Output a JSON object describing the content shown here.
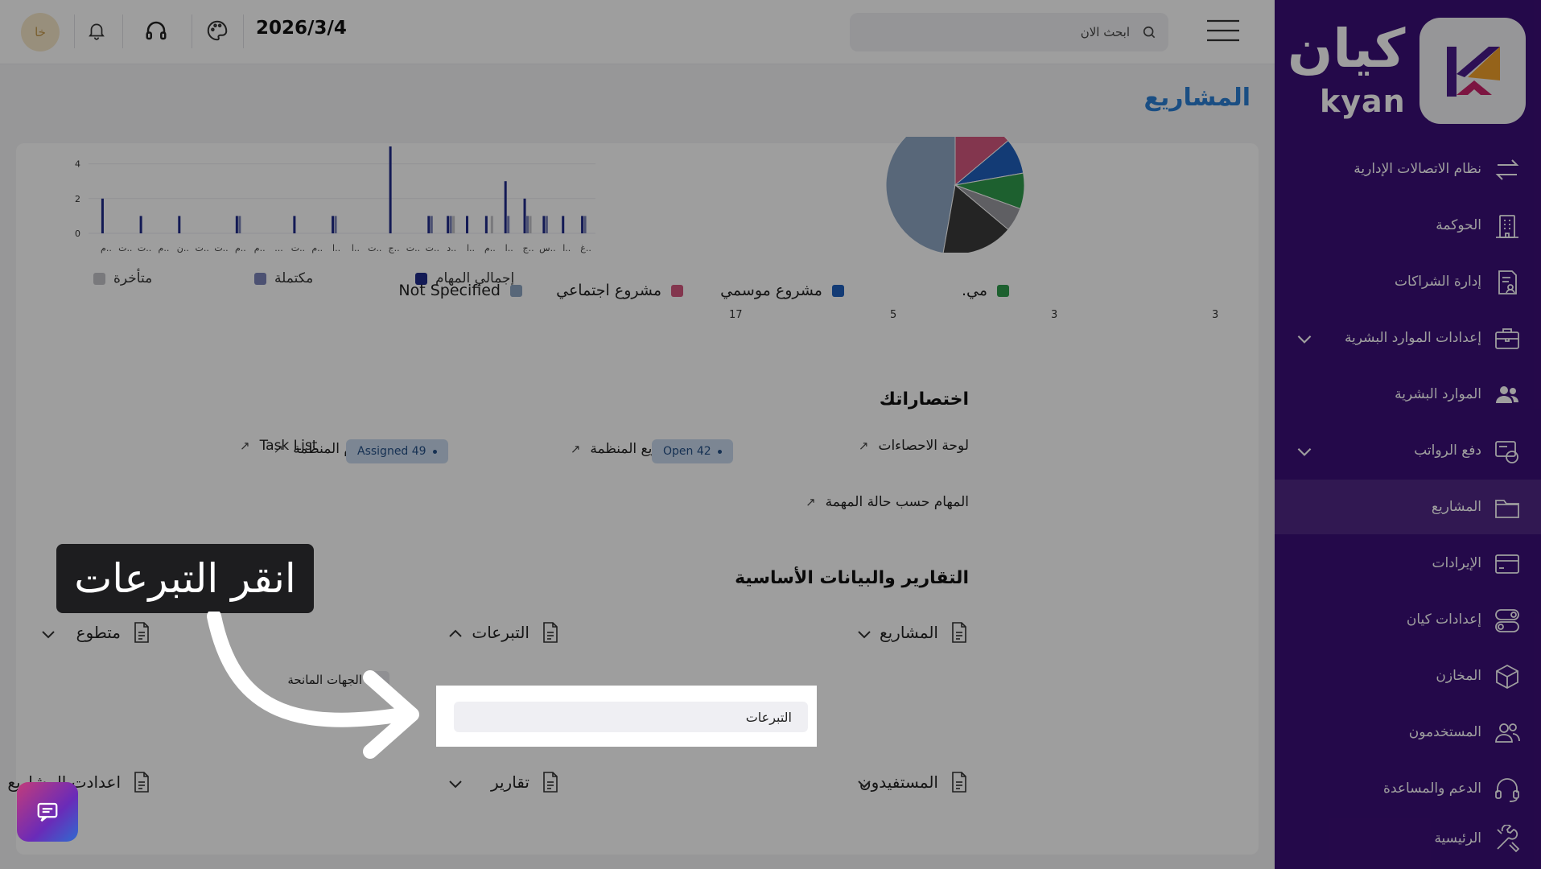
{
  "topbar": {
    "avatar_initials": "خا",
    "date": "2026/3/4",
    "search_placeholder": "ابحث الان"
  },
  "page_title": "المشاريع",
  "bar_chart": {
    "chart_data": {
      "type": "bar",
      "categories": [
        "م..",
        "ت..",
        "ت..",
        "م..",
        "ن..",
        "ت..",
        "ت..",
        "م..",
        "م..",
        "...",
        "ت..",
        "م..",
        "ا..",
        "ا..",
        "ت..",
        "ج..",
        "ت..",
        "ت..",
        "د..",
        "ا..",
        "م..",
        "ا..",
        "ج..",
        "س..",
        "ا..",
        "غ.."
      ],
      "series": [
        {
          "name": "إجمالي المهام",
          "values": [
            2,
            0,
            1,
            0,
            1,
            0,
            0,
            1,
            0,
            0,
            1,
            0,
            1,
            0,
            0,
            5,
            0,
            1,
            1,
            1,
            1,
            3,
            2,
            1,
            1,
            1
          ]
        },
        {
          "name": "مكتملة",
          "values": [
            0,
            0,
            0,
            0,
            0,
            0,
            0,
            1,
            0,
            0,
            0,
            0,
            1,
            0,
            0,
            0,
            0,
            1,
            1,
            0,
            0,
            1,
            1,
            1,
            0,
            1
          ]
        },
        {
          "name": "متأخرة",
          "values": [
            0,
            0,
            0,
            0,
            0,
            0,
            0,
            0,
            0,
            0,
            0,
            0,
            0,
            0,
            0,
            0,
            0,
            0,
            1,
            0,
            1,
            0,
            1,
            0,
            0,
            0
          ]
        }
      ],
      "ylim": [
        0,
        5
      ],
      "yticks": [
        "0",
        "2",
        "4"
      ],
      "legend": "bottom"
    },
    "colors": {
      "total": "#1f2a8a",
      "completed": "#7b83b8",
      "late": "#c4c4c8"
    }
  },
  "pie_chart": {
    "chart_data": {
      "type": "pie",
      "labels": [
        "Not Specified",
        "مشروع اجتماعي",
        "مشروع موسمي",
        "مي."
      ],
      "values": [
        17,
        5,
        3,
        3
      ],
      "value_labels": [
        "17",
        "5",
        "3",
        "3"
      ]
    },
    "colors": [
      "#8ea7c4",
      "#d3577f",
      "#1f5fbd",
      "#2f9b4c",
      "#9a9aa0",
      "#3a3a3a"
    ]
  },
  "shortcuts": {
    "title": "اختصاراتك",
    "items": [
      {
        "label": "لوحة الاحصاءات"
      },
      {
        "label": "مشاريع المنظمة"
      },
      {
        "label": "مهام المنظمة",
        "badge": "Open 42"
      },
      {
        "label": "Task List",
        "badge": "Assigned 49"
      },
      {
        "label": "المهام حسب حالة المهمة"
      }
    ]
  },
  "reports": {
    "title": "التقارير والبيانات الأساسية",
    "row1": [
      "المشاريع",
      "التبرعات",
      "متطوع"
    ],
    "row2": [
      "المستفيدون",
      "تقارير",
      "اعدادت المشاريع"
    ],
    "submenu": [
      "الجهات المانحة",
      "التبرعات"
    ]
  },
  "sidebar": {
    "brand_ar": "كيان",
    "brand_en": "kyan",
    "items": [
      {
        "label": "نظام الاتصالات الإدارية",
        "icon": "arrows-exchange-icon"
      },
      {
        "label": "الحوكمة",
        "icon": "building-icon"
      },
      {
        "label": "إدارة الشراكات",
        "icon": "document-user-icon"
      },
      {
        "label": "إعدادات الموارد البشرية",
        "icon": "briefcase-icon"
      },
      {
        "label": "الموارد البشرية",
        "icon": "users-icon"
      },
      {
        "label": "دفع الرواتب",
        "icon": "coins-icon"
      },
      {
        "label": "المشاريع",
        "icon": "folder-icon"
      },
      {
        "label": "الإيرادات",
        "icon": "card-icon"
      },
      {
        "label": "إعدادات كيان",
        "icon": "toggle-icon"
      },
      {
        "label": "المخازن",
        "icon": "box-icon"
      },
      {
        "label": "المستخدمون",
        "icon": "user-group-icon"
      },
      {
        "label": "الدعم والمساعدة",
        "icon": "headset-icon"
      },
      {
        "label": "الرئيسية",
        "icon": "tools-icon"
      }
    ]
  },
  "overlay": {
    "tip": "انقر التبرعات"
  }
}
